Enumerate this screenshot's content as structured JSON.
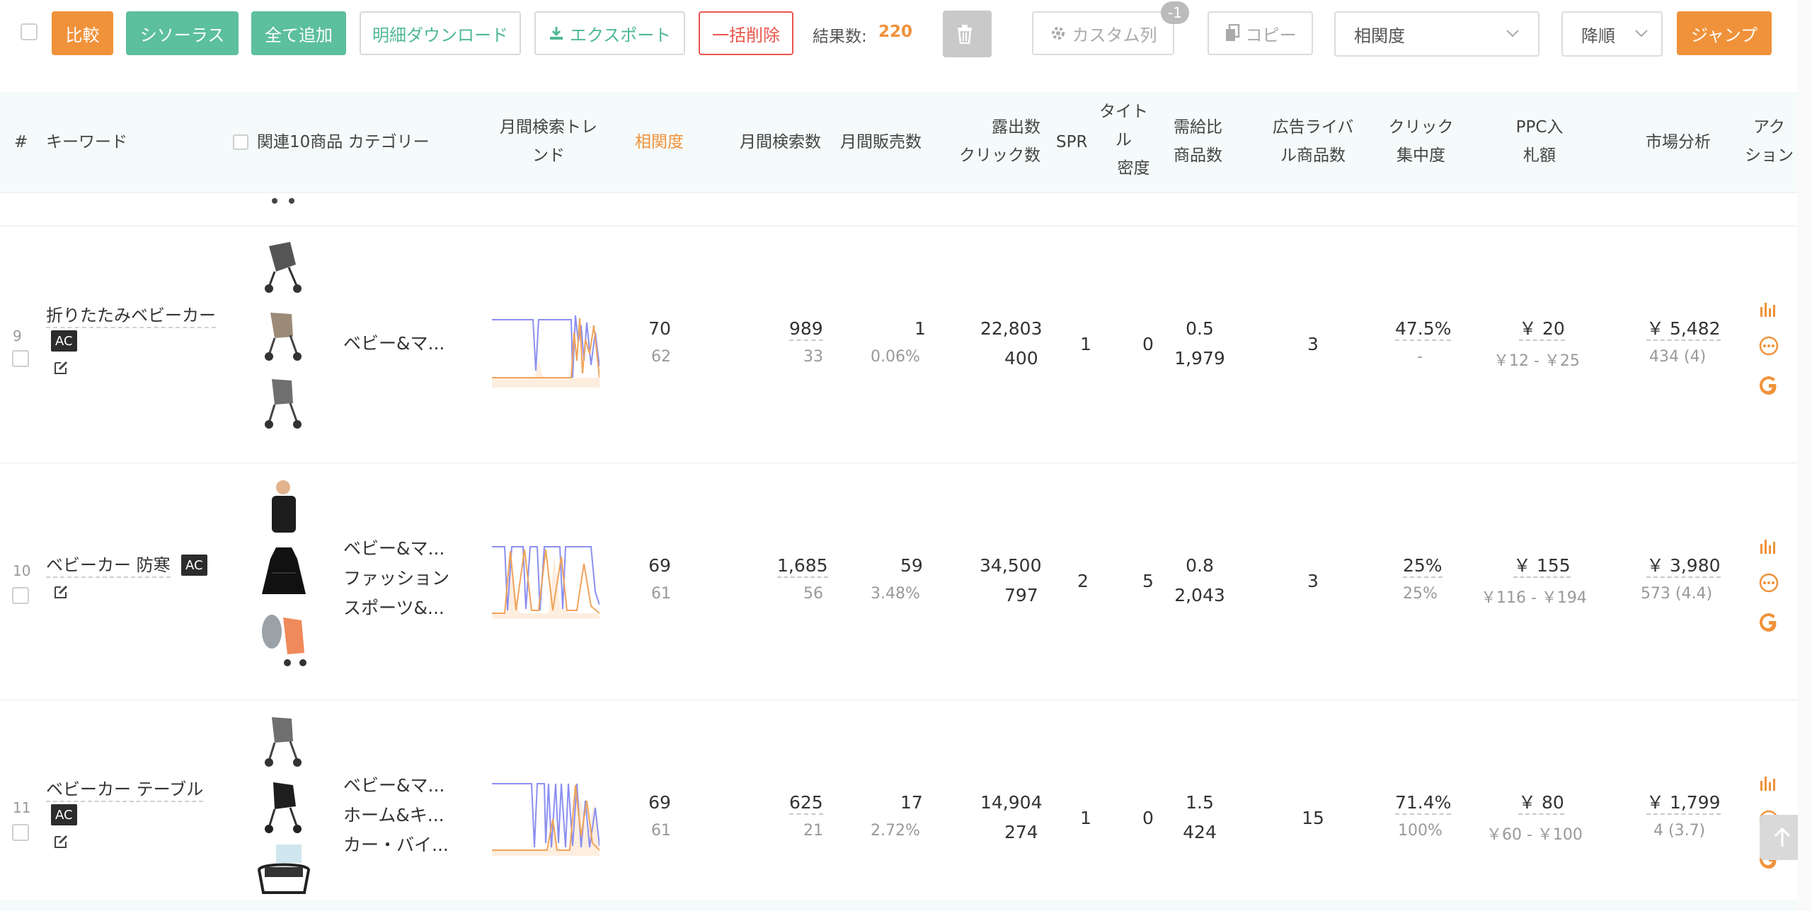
{
  "toolbar": {
    "compare": "比較",
    "thesaurus": "シソーラス",
    "add_all": "全て追加",
    "detail_download": "明細ダウンロード",
    "export": "エクスポート",
    "bulk_delete": "一括削除",
    "result_label": "結果数:",
    "result_count": "220",
    "custom_columns": "カスタム列",
    "custom_badge": "-1",
    "copy": "コピー",
    "sort_field": "相関度",
    "sort_order": "降順",
    "jump": "ジャンプ"
  },
  "columns": {
    "index": "#",
    "keyword": "キーワード",
    "products_category": "関連10商品 カテゴリー",
    "trend_l1": "月間検索トレ",
    "trend_l2": "ンド",
    "relevance": "相関度",
    "monthly_search": "月間検索数",
    "monthly_sales": "月間販売数",
    "exposure_l1": "露出数",
    "exposure_l2": "クリック数",
    "spr": "SPR",
    "title_l1": "タイト",
    "title_l2": "ル",
    "title_l3": "密度",
    "supply_l1": "需給比",
    "supply_l2": "商品数",
    "ad_l1": "広告ライバ",
    "ad_l2": "ル商品数",
    "click_l1": "クリック",
    "click_l2": "集中度",
    "ppc_l1": "PPC入",
    "ppc_l2": "札額",
    "market": "市場分析",
    "action_l1": "アク",
    "action_l2": "ション"
  },
  "rows": [
    {
      "index": "9",
      "keyword": "折りたたみベビーカー",
      "ac": "AC",
      "categories": [
        "ベビー&マ..."
      ],
      "relevance": "70",
      "relevance_sub": "62",
      "search": "989",
      "search_sub": "33",
      "sales": "1",
      "sales_sub": "0.06%",
      "exposure": "22,803",
      "clicks": "400",
      "spr": "1",
      "title_density": "0",
      "supply_ratio": "0.5",
      "products": "1,979",
      "ad_rivals": "3",
      "click_conc": "47.5%",
      "click_conc_sub": "-",
      "ppc": "￥ 20",
      "ppc_range": "￥12 - ￥25",
      "market": "￥ 5,482",
      "market_sub": "434 (4)"
    },
    {
      "index": "10",
      "keyword": "ベビーカー 防寒",
      "ac": "AC",
      "categories": [
        "ベビー&マ...",
        "ファッション",
        "スポーツ&..."
      ],
      "relevance": "69",
      "relevance_sub": "61",
      "search": "1,685",
      "search_sub": "56",
      "sales": "59",
      "sales_sub": "3.48%",
      "exposure": "34,500",
      "clicks": "797",
      "spr": "2",
      "title_density": "5",
      "supply_ratio": "0.8",
      "products": "2,043",
      "ad_rivals": "3",
      "click_conc": "25%",
      "click_conc_sub": "25%",
      "ppc": "￥ 155",
      "ppc_range": "￥116 - ￥194",
      "market": "￥ 3,980",
      "market_sub": "573 (4.4)"
    },
    {
      "index": "11",
      "keyword": "ベビーカー テーブル",
      "ac": "AC",
      "categories": [
        "ベビー&マ...",
        "ホーム&キ...",
        "カー・バイ..."
      ],
      "relevance": "69",
      "relevance_sub": "61",
      "search": "625",
      "search_sub": "21",
      "sales": "17",
      "sales_sub": "2.72%",
      "exposure": "14,904",
      "clicks": "274",
      "spr": "1",
      "title_density": "0",
      "supply_ratio": "1.5",
      "products": "424",
      "ad_rivals": "15",
      "click_conc": "71.4%",
      "click_conc_sub": "100%",
      "ppc": "￥ 80",
      "ppc_range": "￥60 - ￥100",
      "market": "￥ 1,799",
      "market_sub": "4 (3.7)"
    }
  ],
  "colors": {
    "accent_orange": "#f0923a",
    "accent_green": "#5cbf9e",
    "danger_red": "#e9564d",
    "trend_blue": "#8b8ff0",
    "trend_orange": "#f0a35a"
  }
}
